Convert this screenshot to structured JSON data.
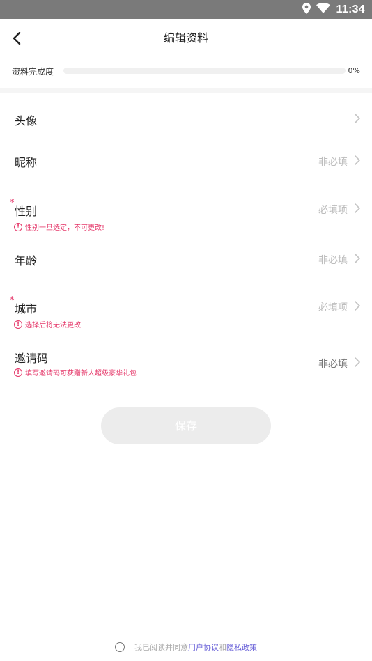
{
  "status_bar": {
    "time": "11:34",
    "icons": [
      "location-icon",
      "wifi-icon"
    ]
  },
  "nav": {
    "title": "编辑资料",
    "back_icon": "chevron-left-icon"
  },
  "progress": {
    "label": "资料完成度",
    "percent_text": "0%",
    "value": 0
  },
  "rows": {
    "avatar": {
      "label": "头像",
      "value": ""
    },
    "nickname": {
      "label": "昵称",
      "value": "非必填"
    },
    "gender": {
      "label": "性别",
      "required_mark": "*",
      "value": "必填项",
      "hint": "性别一旦选定，不可更改!"
    },
    "age": {
      "label": "年龄",
      "value": "非必填"
    },
    "city": {
      "label": "城市",
      "required_mark": "*",
      "value": "必填项",
      "hint": "选择后将无法更改"
    },
    "invite": {
      "label": "邀请码",
      "value": "非必填",
      "hint": "填写邀请码可获赠新人超级豪华礼包"
    }
  },
  "save_button": {
    "label": "保存"
  },
  "agreement": {
    "prefix": "我已阅读并同意",
    "user_agreement": "用户协议",
    "conjunction": "和",
    "privacy_policy": "隐私政策"
  },
  "colors": {
    "accent": "#e5386a",
    "link": "#6a62d8",
    "status_bar": "#7a7a7a",
    "button_disabled": "#ececec"
  }
}
